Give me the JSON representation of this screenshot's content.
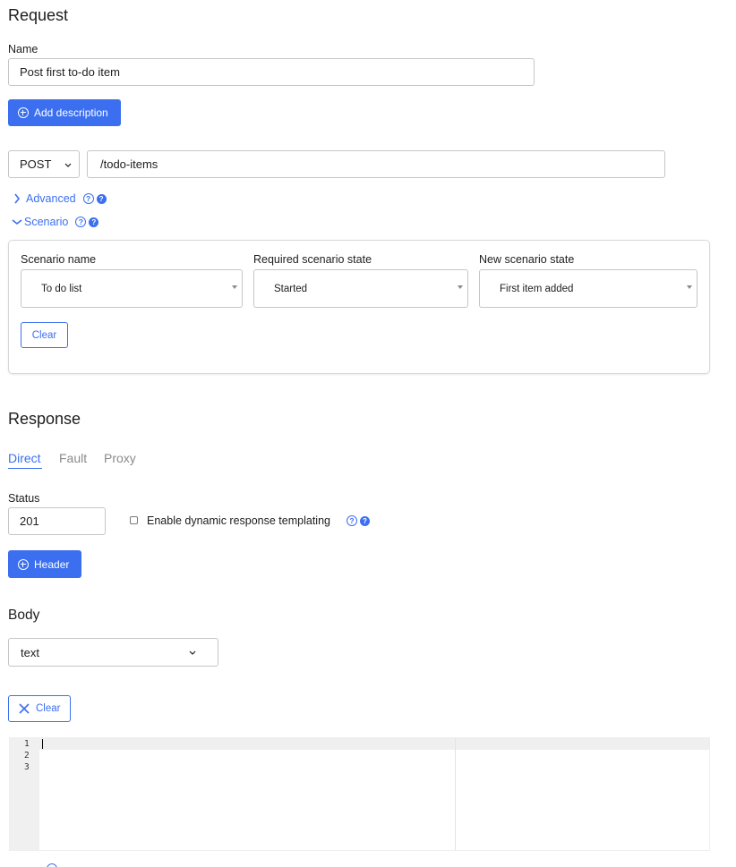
{
  "request": {
    "heading": "Request",
    "name_label": "Name",
    "name_value": "Post first to-do item",
    "add_description_label": "Add description",
    "method": "POST",
    "url": "/todo-items",
    "advanced_label": "Advanced",
    "scenario_label": "Scenario",
    "scenario": {
      "name_label": "Scenario name",
      "name_value": "To do list",
      "required_state_label": "Required scenario state",
      "required_state_value": "Started",
      "new_state_label": "New scenario state",
      "new_state_value": "First item added",
      "clear_label": "Clear"
    }
  },
  "response": {
    "heading": "Response",
    "tabs": [
      {
        "label": "Direct",
        "active": true
      },
      {
        "label": "Fault",
        "active": false
      },
      {
        "label": "Proxy",
        "active": false
      }
    ],
    "status_label": "Status",
    "status_value": "201",
    "templating_label": "Enable dynamic response templating",
    "templating_checked": false,
    "header_button_label": "Header"
  },
  "body": {
    "heading": "Body",
    "format_value": "text",
    "clear_label": "Clear",
    "line_numbers": [
      "1",
      "2",
      "3"
    ]
  },
  "help_glyph": "?",
  "colors": {
    "accent": "#3b6ff0",
    "text": "#1d1d1f",
    "muted": "#8a8a8e",
    "border": "#c6c6c8"
  }
}
